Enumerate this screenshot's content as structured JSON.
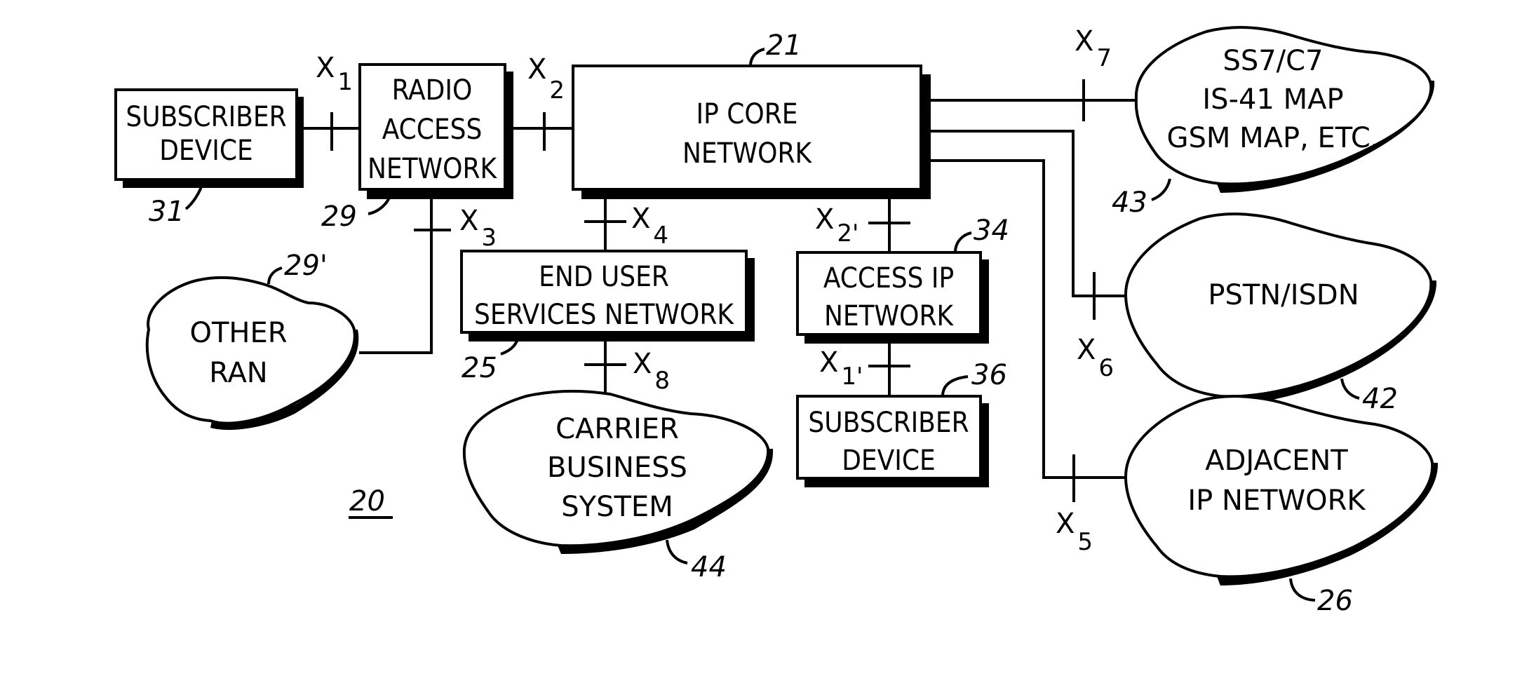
{
  "figure_label": "20",
  "nodes": {
    "subscriber_device_31": {
      "lines": [
        "SUBSCRIBER",
        "DEVICE"
      ],
      "ref": "31"
    },
    "radio_access_network_29": {
      "lines": [
        "RADIO",
        "ACCESS",
        "NETWORK"
      ],
      "ref": "29"
    },
    "ip_core_network_21": {
      "lines": [
        "IP CORE",
        "NETWORK"
      ],
      "ref": "21"
    },
    "other_ran_29p": {
      "lines": [
        "OTHER",
        "RAN"
      ],
      "ref": "29'"
    },
    "end_user_services_25": {
      "lines": [
        "END USER",
        "SERVICES NETWORK"
      ],
      "ref": "25"
    },
    "access_ip_network_34": {
      "lines": [
        "ACCESS IP",
        "NETWORK"
      ],
      "ref": "34"
    },
    "subscriber_device_36": {
      "lines": [
        "SUBSCRIBER",
        "DEVICE"
      ],
      "ref": "36"
    },
    "carrier_business_44": {
      "lines": [
        "CARRIER",
        "BUSINESS",
        "SYSTEM"
      ],
      "ref": "44"
    },
    "ss7_43": {
      "lines": [
        "SS7/C7",
        "IS-41 MAP",
        "GSM MAP, ETC."
      ],
      "ref": "43"
    },
    "pstn_42": {
      "lines": [
        "PSTN/ISDN"
      ],
      "ref": "42"
    },
    "adjacent_ip_26": {
      "lines": [
        "ADJACENT",
        "IP NETWORK"
      ],
      "ref": "26"
    }
  },
  "interfaces": {
    "x1": {
      "base": "X",
      "sub": "1"
    },
    "x2": {
      "base": "X",
      "sub": "2"
    },
    "x3": {
      "base": "X",
      "sub": "3"
    },
    "x4": {
      "base": "X",
      "sub": "4"
    },
    "x5": {
      "base": "X",
      "sub": "5"
    },
    "x6": {
      "base": "X",
      "sub": "6"
    },
    "x7": {
      "base": "X",
      "sub": "7"
    },
    "x8": {
      "base": "X",
      "sub": "8"
    },
    "x2p": {
      "base": "X",
      "sub": "2'"
    },
    "x1p": {
      "base": "X",
      "sub": "1'"
    }
  }
}
